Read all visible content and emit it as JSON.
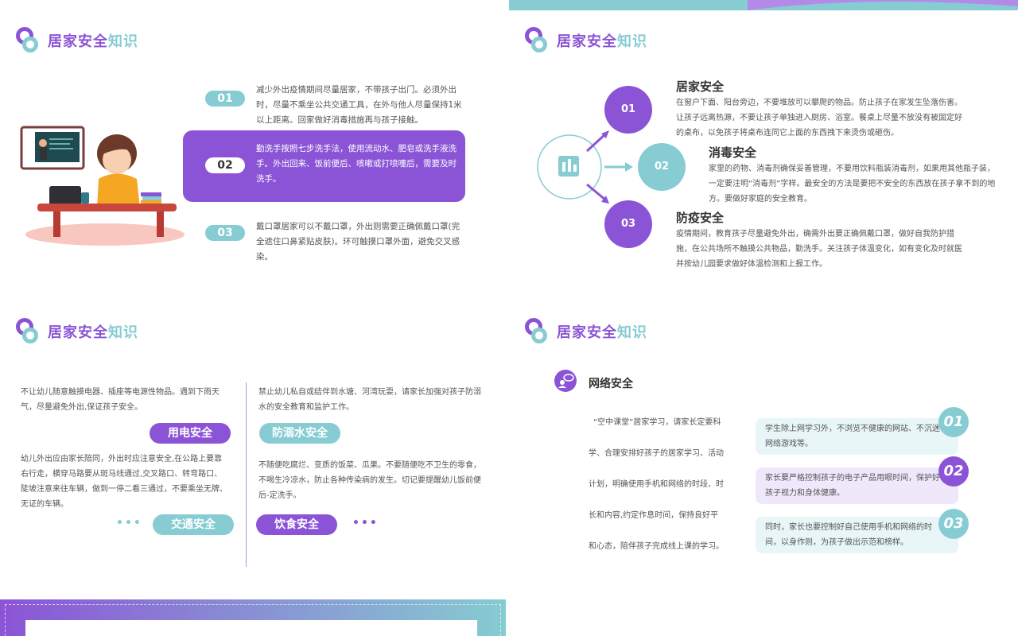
{
  "header_title": {
    "part1": "居家安全",
    "part2": "知识"
  },
  "slide1": {
    "items": [
      {
        "num": "01",
        "text": "减少外出疫情期间尽量居家，不带孩子出门。必须外出时，尽量不乘坐公共交通工具，在外与他人尽量保持1米以上距离。回家做好消毒措施再与孩子接触。"
      },
      {
        "num": "02",
        "text": "勤洗手按照七步洗手法，使用流动水、肥皂或洗手液洗手。外出回来、饭前便后、咳嗽或打喷嚏后，需要及时洗手。"
      },
      {
        "num": "03",
        "text": "戴口罩居家可以不戴口罩，外出则需要正确佩戴口罩(完全遮住口鼻紧贴皮肤)。环可触摸口罩外面，避免交叉感染。"
      }
    ]
  },
  "slide2": {
    "nodes": [
      "01",
      "02",
      "03"
    ],
    "sections": [
      {
        "title": "居家安全",
        "text": "在窗户下面、阳台旁边，不要堆放可以攀爬的物品。防止孩子在家发生坠落伤害。让孩子远离热源，不要让孩子单独进入厨房、浴室。餐桌上尽量不放没有被固定好的桌布，以免孩子将桌布连同它上面的东西拽下来烫伤或砸伤。"
      },
      {
        "title": "消毒安全",
        "text": "家里的药物、消毒剂确保妥善管理，不要用饮料瓶装消毒剂，如果用其他瓶子装，一定要注明“消毒剂”字样。最安全的方法是要把不安全的东西放在孩子拿不到的地方。要做好家庭的安全教育。"
      },
      {
        "title": "防疫安全",
        "text": "疫情期间，教育孩子尽量避免外出，确需外出要正确佩戴口罩，做好自我防护措施，在公共场所不触摸公共物品，勤洗手。关注孩子体温变化，如有变化及时就医并按幼儿园要求做好体温检测和上报工作。"
      }
    ]
  },
  "slide3": {
    "left_top": "不让幼儿随意触摸电器、插座等电源性物品。遇到下雨天气，尽量避免外出,保证孩子安全。",
    "tag_electric": "用电安全",
    "left_bottom": "幼儿外出应由家长陪同，外出时应注意安全,在公路上要靠右行走，横穿马路要从斑马线通过,交叉路口、转弯路口、陡坡注意来往车辆，做到一停二看三通过，不要乘坐无牌、无证的车辆。",
    "tag_traffic": "交通安全",
    "right_top": "禁止幼儿私自或结伴到水塘、河湾玩耍，请家长加强对孩子防溺水的安全教育和监护工作。",
    "tag_water": "防溺水安全",
    "right_bottom": "不随便吃腐烂、变质的饭菜、瓜果。不要随便吃不卫生的零食，不喝生冷凉水，防止各种传染病的发生。切记要提醒幼儿饭前便后-定洗手。",
    "tag_food": "饮食安全",
    "dots": "•••"
  },
  "slide4": {
    "subtitle": "网络安全",
    "lines": [
      "“空中课堂”居家学习，请家长定要科",
      "学、合理安排好孩子的居家学习、活动",
      "计划，明确使用手机和网络的时段、时",
      "长和内容,约定作息时间，保持良好平",
      "和心态，陪伴孩子完成线上课的学习。"
    ],
    "cards": [
      {
        "num": "01",
        "text": "学生除上网学习外，不浏览不健康的网站、不沉迷网络游戏等。"
      },
      {
        "num": "02",
        "text": "家长要严格控制孩子的电子产品用眼时间，保护好孩子视力和身体健康。"
      },
      {
        "num": "03",
        "text": "同时，家长也要控制好自己使用手机和网络的时间，以身作则，为孩子做出示范和榜样。"
      }
    ]
  },
  "colors": {
    "purple": "#8b54d6",
    "teal": "#86ccd2",
    "lavender": "#efe8fb",
    "aqua": "#e8f6f7"
  }
}
